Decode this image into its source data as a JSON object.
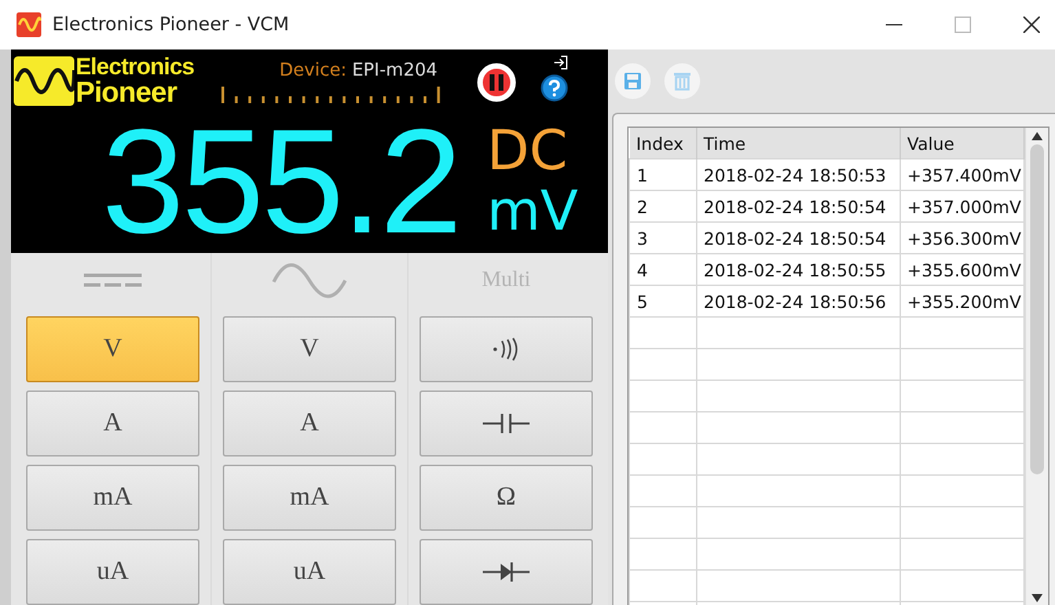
{
  "window": {
    "title": "Electronics Pioneer - VCM"
  },
  "display": {
    "brand": [
      "Electronics",
      "Pioneer"
    ],
    "device_label": "Device:",
    "device": "EPI-m204",
    "reading": "355.2",
    "coupling": "DC",
    "unit": "mV"
  },
  "modes": [
    {
      "kind": "dc",
      "buttons": [
        {
          "kind": "text",
          "label": "V",
          "selected": true
        },
        {
          "kind": "text",
          "label": "A",
          "selected": false
        },
        {
          "kind": "text",
          "label": "mA",
          "selected": false
        },
        {
          "kind": "text",
          "label": "uA",
          "selected": false
        }
      ]
    },
    {
      "kind": "ac",
      "buttons": [
        {
          "kind": "text",
          "label": "V",
          "selected": false
        },
        {
          "kind": "text",
          "label": "A",
          "selected": false
        },
        {
          "kind": "text",
          "label": "mA",
          "selected": false
        },
        {
          "kind": "text",
          "label": "uA",
          "selected": false
        }
      ]
    },
    {
      "kind": "text",
      "header": "Multi",
      "buttons": [
        {
          "kind": "continuity",
          "selected": false
        },
        {
          "kind": "capacitor",
          "selected": false
        },
        {
          "kind": "text",
          "label": "Ω",
          "selected": false
        },
        {
          "kind": "diode",
          "selected": false
        }
      ]
    }
  ],
  "table": {
    "columns": [
      "Index",
      "Time",
      "Value"
    ],
    "rows": [
      [
        "1",
        "2018-02-24 18:50:53",
        "+357.400mV"
      ],
      [
        "2",
        "2018-02-24 18:50:54",
        "+357.000mV"
      ],
      [
        "3",
        "2018-02-24 18:50:54",
        "+356.300mV"
      ],
      [
        "4",
        "2018-02-24 18:50:55",
        "+355.600mV"
      ],
      [
        "5",
        "2018-02-24 18:50:56",
        "+355.200mV"
      ]
    ]
  }
}
